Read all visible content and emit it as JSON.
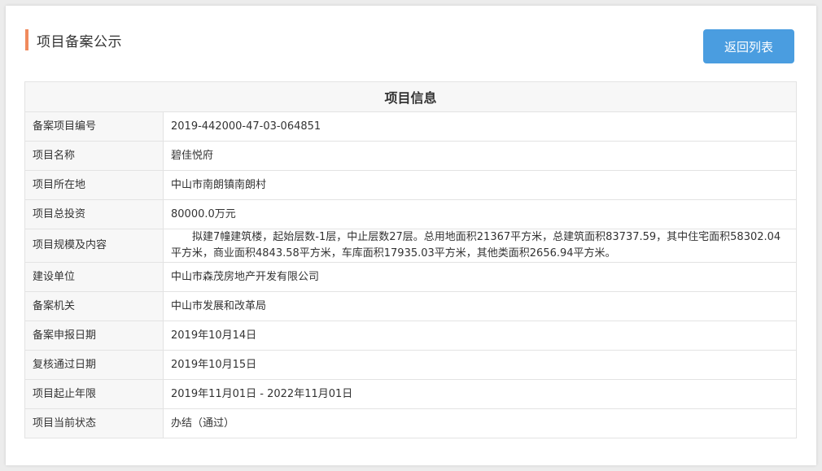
{
  "header": {
    "title": "项目备案公示",
    "accent_color": "#f08a5d"
  },
  "back_button": {
    "label": "返回列表",
    "color": "#4a9de0"
  },
  "table": {
    "title": "项目信息",
    "rows": [
      {
        "label": "备案项目编号",
        "value": "2019-442000-47-03-064851"
      },
      {
        "label": "项目名称",
        "value": "碧佳悦府"
      },
      {
        "label": "项目所在地",
        "value": "中山市南朗镇南朗村"
      },
      {
        "label": "项目总投资",
        "value": "80000.0万元"
      },
      {
        "label": "项目规模及内容",
        "value": "拟建7幢建筑楼，起始层数-1层，中止层数27层。总用地面积21367平方米，总建筑面积83737.59，其中住宅面积58302.04平方米，商业面积4843.58平方米，车库面积17935.03平方米，其他类面积2656.94平方米。"
      },
      {
        "label": "建设单位",
        "value": "中山市森茂房地产开发有限公司"
      },
      {
        "label": "备案机关",
        "value": "中山市发展和改革局"
      },
      {
        "label": "备案申报日期",
        "value": "2019年10月14日"
      },
      {
        "label": "复核通过日期",
        "value": "2019年10月15日"
      },
      {
        "label": "项目起止年限",
        "value": "2019年11月01日 - 2022年11月01日"
      },
      {
        "label": "项目当前状态",
        "value": "办结（通过）"
      }
    ]
  }
}
